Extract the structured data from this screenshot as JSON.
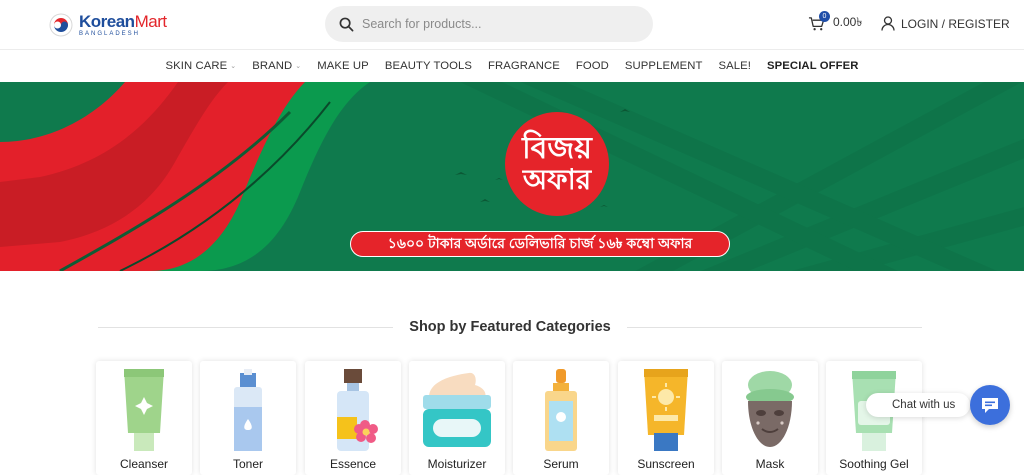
{
  "header": {
    "logo": {
      "brand_korean": "Korean",
      "brand_mart": "Mart",
      "brand_sub": "BANGLADESH"
    },
    "search": {
      "placeholder": "Search for products..."
    },
    "cart": {
      "count": "0",
      "amount": "0.00৳"
    },
    "login_label": "LOGIN / REGISTER"
  },
  "nav": {
    "items": [
      {
        "label": "SKIN CARE",
        "dropdown": true
      },
      {
        "label": "BRAND",
        "dropdown": true
      },
      {
        "label": "MAKE UP",
        "dropdown": false
      },
      {
        "label": "BEAUTY TOOLS",
        "dropdown": false
      },
      {
        "label": "FRAGRANCE",
        "dropdown": false
      },
      {
        "label": "FOOD",
        "dropdown": false
      },
      {
        "label": "SUPPLEMENT",
        "dropdown": false
      },
      {
        "label": "SALE!",
        "dropdown": false
      },
      {
        "label": "SPECIAL OFFER",
        "dropdown": false
      }
    ],
    "caret": "⌄"
  },
  "banner": {
    "badge_line1": "বিজয়",
    "badge_line2": "অফার",
    "offer_text": "১৬০০ টাকার অর্ডারে ডেলিভারি চার্জ ১৬৳ কম্বো অফার",
    "colors": {
      "green": "#0f7a4d",
      "red": "#e5242a"
    }
  },
  "section": {
    "title": "Shop by Featured Categories"
  },
  "categories": [
    {
      "label": "Cleanser",
      "icon": "cleanser-tube-icon"
    },
    {
      "label": "Toner",
      "icon": "toner-bottle-icon"
    },
    {
      "label": "Essence",
      "icon": "essence-bottle-icon"
    },
    {
      "label": "Moisturizer",
      "icon": "moisturizer-jar-icon"
    },
    {
      "label": "Serum",
      "icon": "serum-dropper-icon"
    },
    {
      "label": "Sunscreen",
      "icon": "sunscreen-tube-icon"
    },
    {
      "label": "Mask",
      "icon": "face-mask-icon"
    },
    {
      "label": "Soothing Gel",
      "icon": "soothing-gel-tube-icon"
    }
  ],
  "chat": {
    "label": "Chat with us"
  }
}
